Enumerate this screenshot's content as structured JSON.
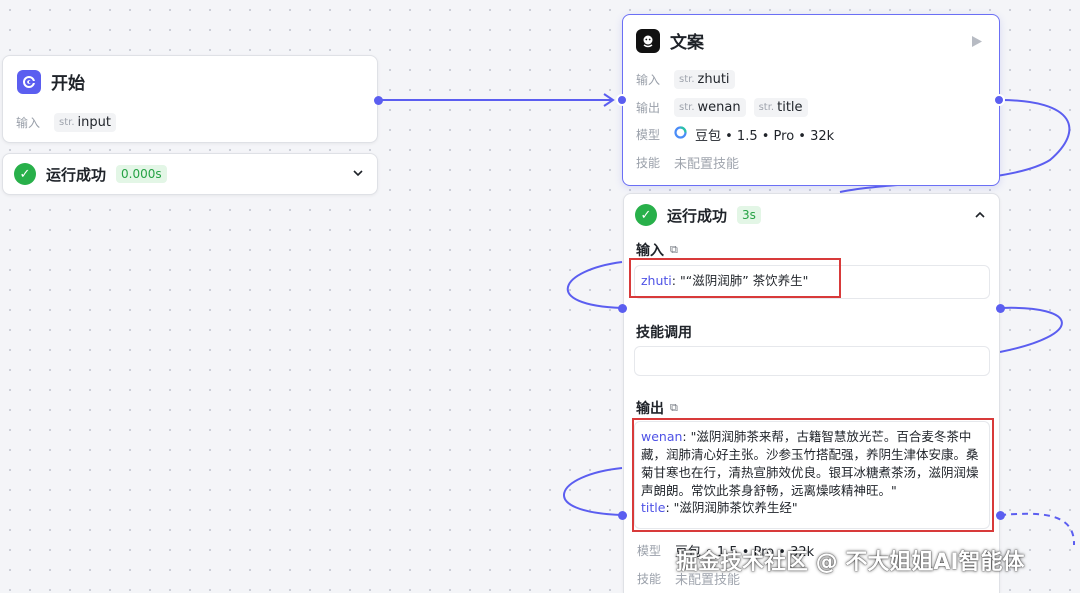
{
  "start_node": {
    "title": "开始",
    "input_label": "输入",
    "input_var": {
      "type": "str.",
      "name": "input"
    }
  },
  "start_status": {
    "label": "运行成功",
    "time": "0.000s"
  },
  "copy_node": {
    "title": "文案",
    "input_label": "输入",
    "inputs": [
      {
        "type": "str.",
        "name": "zhuti"
      }
    ],
    "output_label": "输出",
    "outputs": [
      {
        "type": "str.",
        "name": "wenan"
      },
      {
        "type": "str.",
        "name": "title"
      }
    ],
    "model_label": "模型",
    "model_value": "豆包 • 1.5 • Pro • 32k",
    "skill_label": "技能",
    "skill_value": "未配置技能"
  },
  "copy_status": {
    "label": "运行成功",
    "time": "3s",
    "input_section": "输入",
    "input_key": "zhuti",
    "input_value": ": \"“滋阴润肺” 茶饮养生\"",
    "skill_section": "技能调用",
    "output_section": "输出",
    "output_wenan_key": "wenan",
    "output_wenan_value": ": \"滋阴润肺茶来帮，古籍智慧放光芒。百合麦冬茶中藏，润肺清心好主张。沙参玉竹搭配强，养阴生津体安康。桑菊甘寒也在行，清热宣肺效优良。银耳冰糖煮茶汤，滋阴润燥声朗朗。常饮此茶身舒畅，远离燥咳精神旺。\"",
    "output_title_key": "title",
    "output_title_value": ": \"滋阴润肺茶饮养生经\""
  },
  "lower_node": {
    "model_label": "模型",
    "model_value": "豆包 • 1.5 • Pro • 32k",
    "skill_label": "技能",
    "skill_value": "未配置技能"
  },
  "watermark": "掘金技术社区 @ 不大姐姐AI智能体",
  "colors": {
    "accent": "#5b5ef0",
    "success": "#28b04a",
    "highlight_box": "#d83a3a"
  },
  "icons": {
    "start": "start-icon",
    "copy": "wenan-node-icon",
    "run": "play-icon",
    "success": "check-circle-icon",
    "copy_text": "copy-icon",
    "expand": "chevron-down-icon",
    "collapse": "chevron-up-icon"
  }
}
